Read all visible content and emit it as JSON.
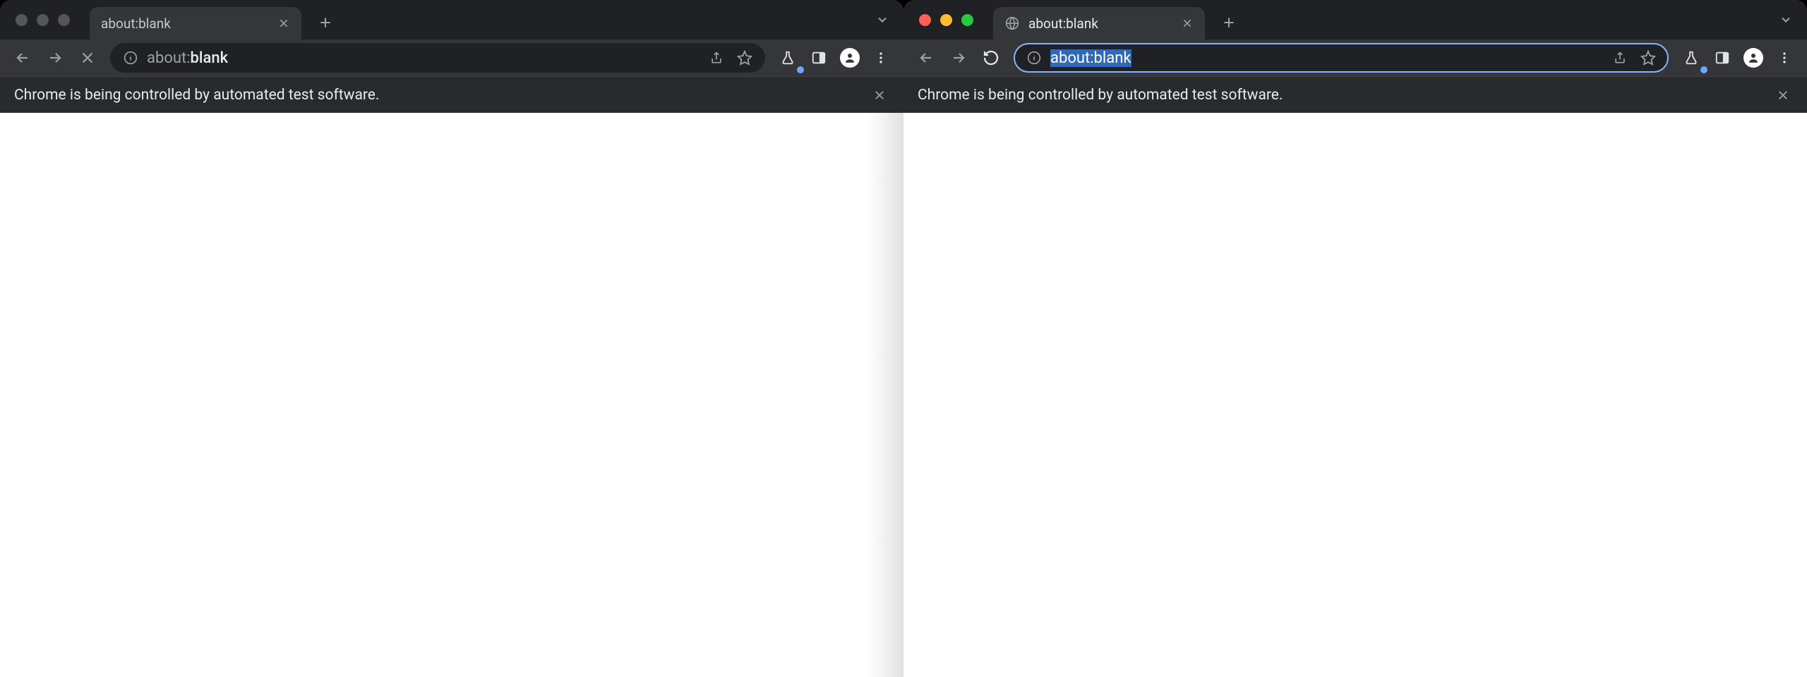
{
  "left_window": {
    "active": false,
    "tab": {
      "title": "about:blank"
    },
    "omnibox": {
      "scheme": "about:",
      "rest": "blank",
      "focused": false,
      "selected": false
    },
    "nav": {
      "back_enabled": false,
      "forward_enabled": false,
      "reload_state": "stop"
    },
    "infobar": {
      "message": "Chrome is being controlled by automated test software."
    }
  },
  "right_window": {
    "active": true,
    "tab": {
      "title": "about:blank"
    },
    "omnibox": {
      "scheme": "about:",
      "rest": "blank",
      "value": "about:blank",
      "focused": true,
      "selected": true
    },
    "nav": {
      "back_enabled": false,
      "forward_enabled": false,
      "reload_state": "reload"
    },
    "infobar": {
      "message": "Chrome is being controlled by automated test software."
    }
  }
}
